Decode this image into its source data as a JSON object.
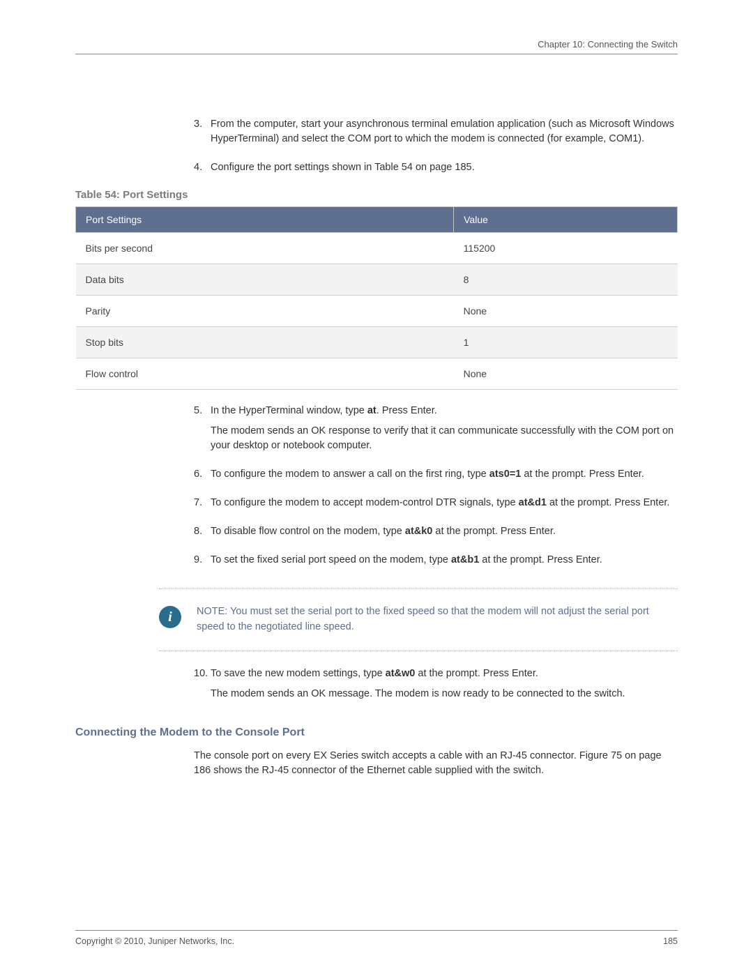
{
  "header": "Chapter 10: Connecting the Switch",
  "steps_a": [
    {
      "num": "3.",
      "html": "From the computer, start your asynchronous terminal emulation application (such as Microsoft Windows HyperTerminal) and select the COM port to which the modem is connected (for example, COM1)."
    },
    {
      "num": "4.",
      "html": "Configure the port settings shown in Table 54 on page 185."
    }
  ],
  "table_caption": "Table 54: Port Settings",
  "table": {
    "head": [
      "Port Settings",
      "Value"
    ],
    "rows": [
      {
        "k": "Bits per second",
        "v": "115200"
      },
      {
        "k": "Data bits",
        "v": "8"
      },
      {
        "k": "Parity",
        "v": "None"
      },
      {
        "k": "Stop bits",
        "v": "1"
      },
      {
        "k": "Flow control",
        "v": "None"
      }
    ]
  },
  "steps_b": [
    {
      "num": "5.",
      "lines": [
        "In the HyperTerminal window, type <b class='cmd'>at</b>. Press Enter.",
        "The modem sends an OK response to verify that it can communicate successfully with the COM port on your desktop or notebook computer."
      ]
    },
    {
      "num": "6.",
      "lines": [
        "To configure the modem to answer a call on the first ring, type <b class='cmd'>ats0=1</b> at the prompt. Press Enter."
      ]
    },
    {
      "num": "7.",
      "lines": [
        "To configure the modem to accept modem-control DTR signals, type <b class='cmd'>at&d1</b> at the prompt. Press Enter."
      ]
    },
    {
      "num": "8.",
      "lines": [
        "To disable flow control on the modem, type <b class='cmd'>at&k0</b> at the prompt. Press Enter."
      ]
    },
    {
      "num": "9.",
      "lines": [
        "To set the fixed serial port speed on the modem, type <b class='cmd'>at&b1</b> at the prompt. Press Enter."
      ]
    }
  ],
  "note": "NOTE:  You must set the serial port to the fixed speed so that the modem will not adjust the serial port speed to the negotiated line speed.",
  "steps_c": [
    {
      "num": "10.",
      "lines": [
        "To save the new modem settings, type <b class='cmd'>at&w0</b> at the prompt. Press Enter.",
        "The modem sends an OK message. The modem is now ready to be connected to the switch."
      ]
    }
  ],
  "subheading": "Connecting the Modem to the Console Port",
  "sub_para": "The console port on every EX Series switch accepts a cable with an RJ-45 connector. Figure 75 on page 186 shows the RJ-45 connector of the Ethernet cable supplied with the switch.",
  "footer": {
    "left": "Copyright © 2010, Juniper Networks, Inc.",
    "right": "185"
  }
}
